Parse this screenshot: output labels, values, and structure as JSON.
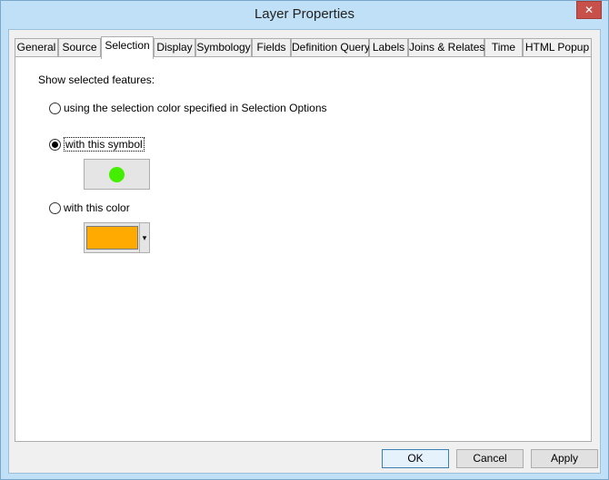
{
  "window": {
    "title": "Layer Properties",
    "close_glyph": "✕"
  },
  "tabs": [
    {
      "label": "General"
    },
    {
      "label": "Source"
    },
    {
      "label": "Selection"
    },
    {
      "label": "Display"
    },
    {
      "label": "Symbology"
    },
    {
      "label": "Fields"
    },
    {
      "label": "Definition Query"
    },
    {
      "label": "Labels"
    },
    {
      "label": "Joins & Relates"
    },
    {
      "label": "Time"
    },
    {
      "label": "HTML Popup"
    }
  ],
  "active_tab": "Selection",
  "selection": {
    "heading": "Show selected features:",
    "options": [
      {
        "label": "using the selection color specified in Selection Options",
        "checked": false
      },
      {
        "label": "with this symbol",
        "checked": true
      },
      {
        "label": "with this color",
        "checked": false
      }
    ],
    "symbol_color": "#44ee00",
    "fill_color": "#ffaa00",
    "dropdown_glyph": "▾"
  },
  "buttons": {
    "ok": "OK",
    "cancel": "Cancel",
    "apply": "Apply"
  }
}
